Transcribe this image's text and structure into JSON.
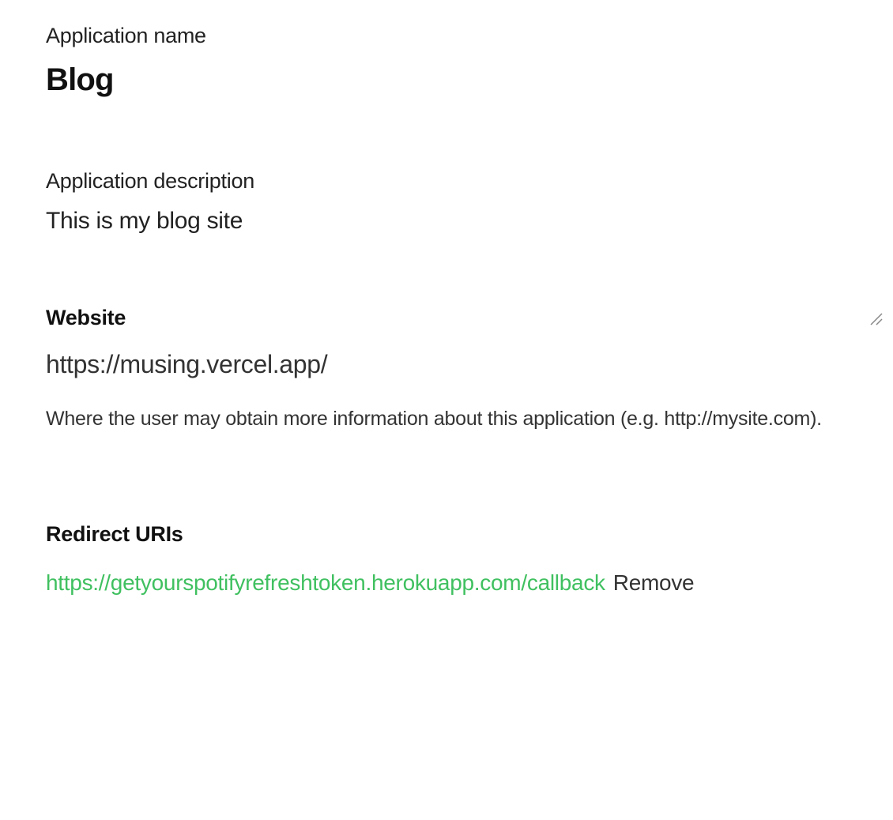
{
  "app_name": {
    "label": "Application name",
    "value": "Blog"
  },
  "app_description": {
    "label": "Application description",
    "value": "This is my blog site"
  },
  "website": {
    "label": "Website",
    "value": "https://musing.vercel.app/",
    "helper": "Where the user may obtain more information about this application (e.g. http://mysite.com)."
  },
  "redirect_uris": {
    "label": "Redirect URIs",
    "items": [
      {
        "url": "https://getyourspotifyrefreshtoken.herokuapp.com/callback",
        "remove_label": "Remove"
      }
    ]
  }
}
